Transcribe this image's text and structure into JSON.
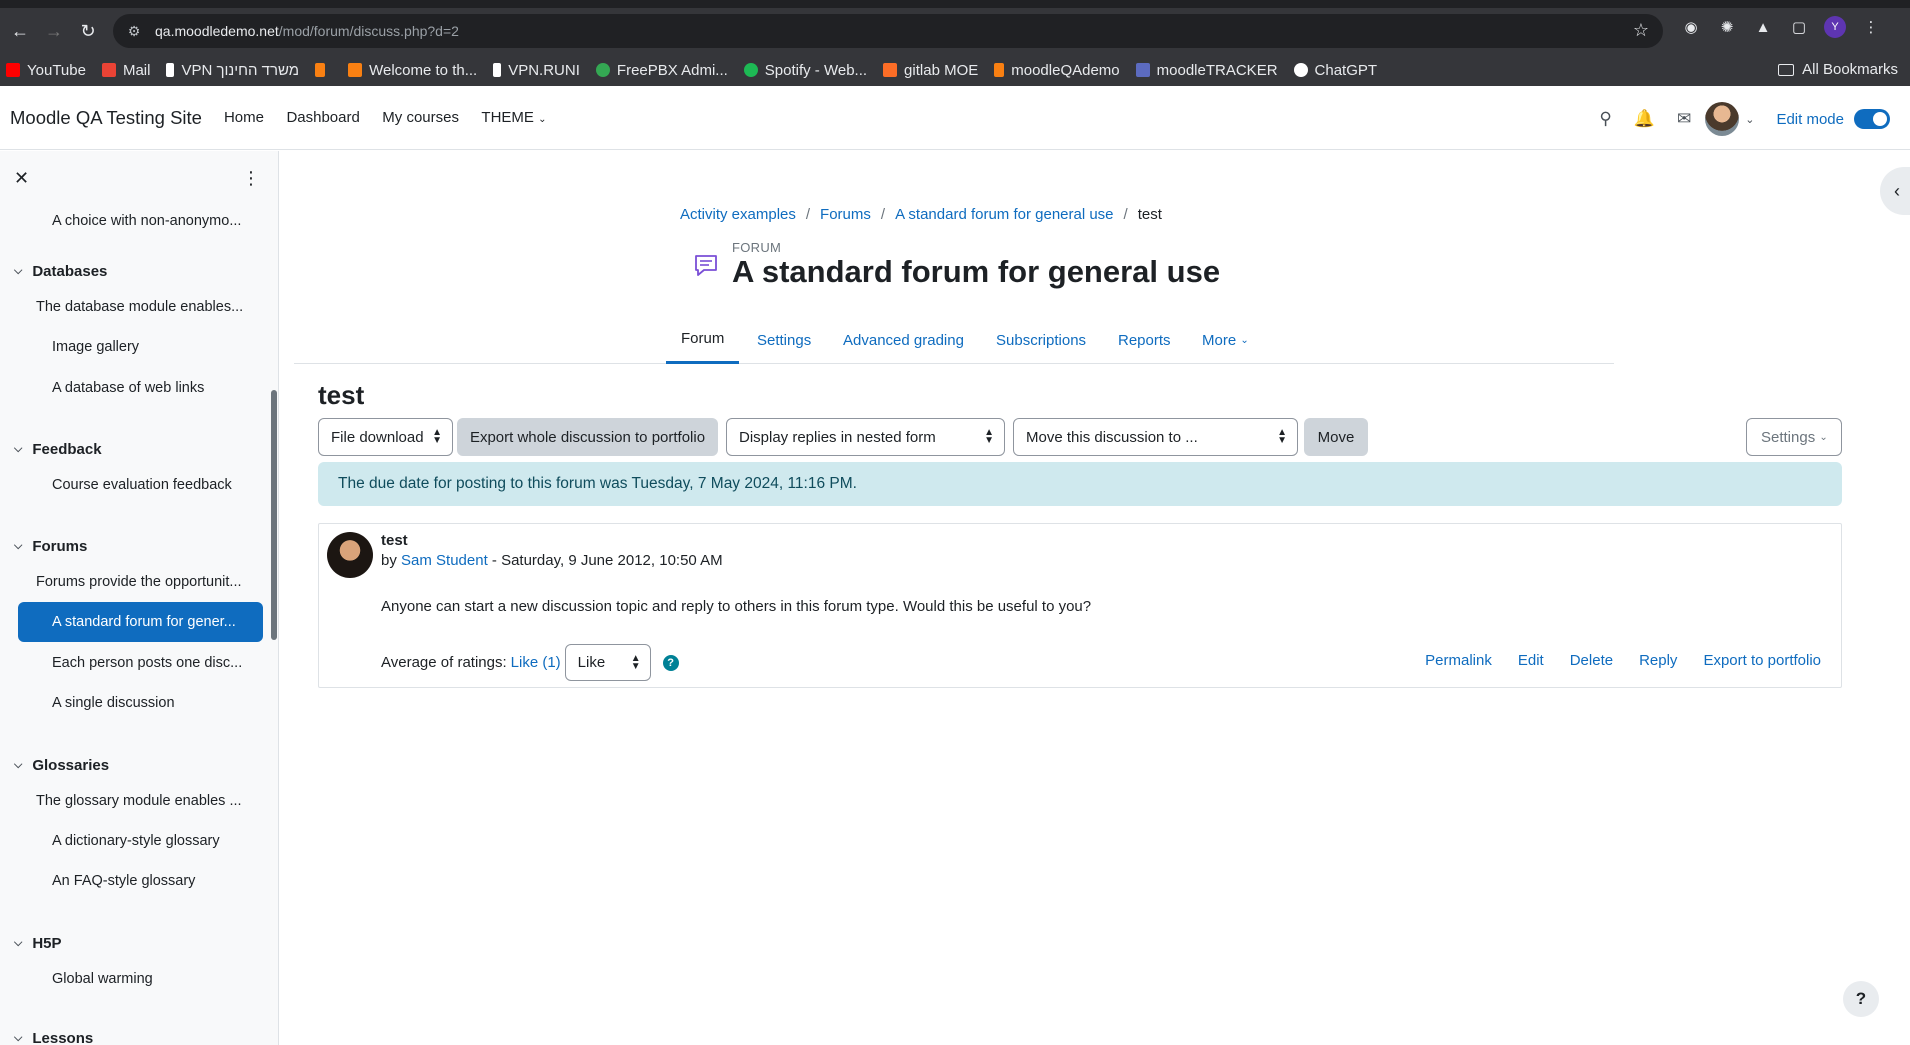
{
  "browser": {
    "url_host": "qa.moodledemo.net",
    "url_path": "/mod/forum/discuss.php?d=2",
    "profile_initial": "Y",
    "bookmarks": [
      {
        "label": "YouTube",
        "color": "#ff0000"
      },
      {
        "label": "Mail",
        "color": "#ea4335"
      },
      {
        "label": "VPN משרד החינוך",
        "color": "#ffffff"
      },
      {
        "label": "",
        "color": "#f98012"
      },
      {
        "label": "Welcome to th...",
        "color": "#f98012"
      },
      {
        "label": "VPN.RUNI",
        "color": "#ffffff"
      },
      {
        "label": "FreePBX Admi...",
        "color": "#34a853"
      },
      {
        "label": "Spotify - Web...",
        "color": "#1db954"
      },
      {
        "label": "gitlab MOE",
        "color": "#fc6d26"
      },
      {
        "label": "moodleQAdemo",
        "color": "#f98012"
      },
      {
        "label": "moodleTRACKER",
        "color": "#5c6bc0"
      },
      {
        "label": "ChatGPT",
        "color": "#ffffff"
      }
    ],
    "all_bookmarks": "All Bookmarks"
  },
  "navbar": {
    "site_name": "Moodle QA Testing Site",
    "links": [
      "Home",
      "Dashboard",
      "My courses",
      "THEME"
    ],
    "edit_mode_label": "Edit mode",
    "edit_mode_on": true
  },
  "drawer": {
    "close_icon": "close-icon",
    "menu_icon": "kebab-icon",
    "top_item": "A choice with non-anonymo...",
    "sections": [
      {
        "title": "Databases",
        "items": [
          "The database module enables...",
          "Image gallery",
          "A database of web links"
        ]
      },
      {
        "title": "Feedback",
        "items": [
          "Course evaluation feedback"
        ]
      },
      {
        "title": "Forums",
        "items": [
          "Forums provide the opportunit...",
          "A standard forum for gener...",
          "Each person posts one disc...",
          "A single discussion"
        ]
      },
      {
        "title": "Glossaries",
        "items": [
          "The glossary module enables ...",
          "A dictionary-style glossary",
          "An FAQ-style glossary"
        ]
      },
      {
        "title": "H5P",
        "items": [
          "Global warming"
        ]
      },
      {
        "title": "Lessons",
        "items": []
      }
    ]
  },
  "breadcrumb": [
    "Activity examples",
    "Forums",
    "A standard forum for general use",
    "test"
  ],
  "header": {
    "module_label": "FORUM",
    "title": "A standard forum for general use"
  },
  "tabs": [
    "Forum",
    "Settings",
    "Advanced grading",
    "Subscriptions",
    "Reports",
    "More"
  ],
  "discussion": {
    "title": "test",
    "export_select": "File download",
    "export_button": "Export whole discussion to portfolio",
    "display_mode": "Display replies in nested form",
    "move_select": "Move this discussion to ...",
    "move_button": "Move",
    "settings_button": "Settings",
    "due_notice": "The due date for posting to this forum was Tuesday, 7 May 2024, 11:16 PM."
  },
  "post": {
    "subject": "test",
    "by_prefix": "by",
    "author": "Sam Student",
    "date": "- Saturday, 9 June 2012, 10:50 AM",
    "body": "Anyone can start a new discussion topic and reply to others in this forum type. Would this be useful to you?",
    "rating_label": "Average of ratings:",
    "rating_value": "Like (1)",
    "rating_select": "Like",
    "actions": [
      "Permalink",
      "Edit",
      "Delete",
      "Reply",
      "Export to portfolio"
    ]
  },
  "help_fab": "?"
}
